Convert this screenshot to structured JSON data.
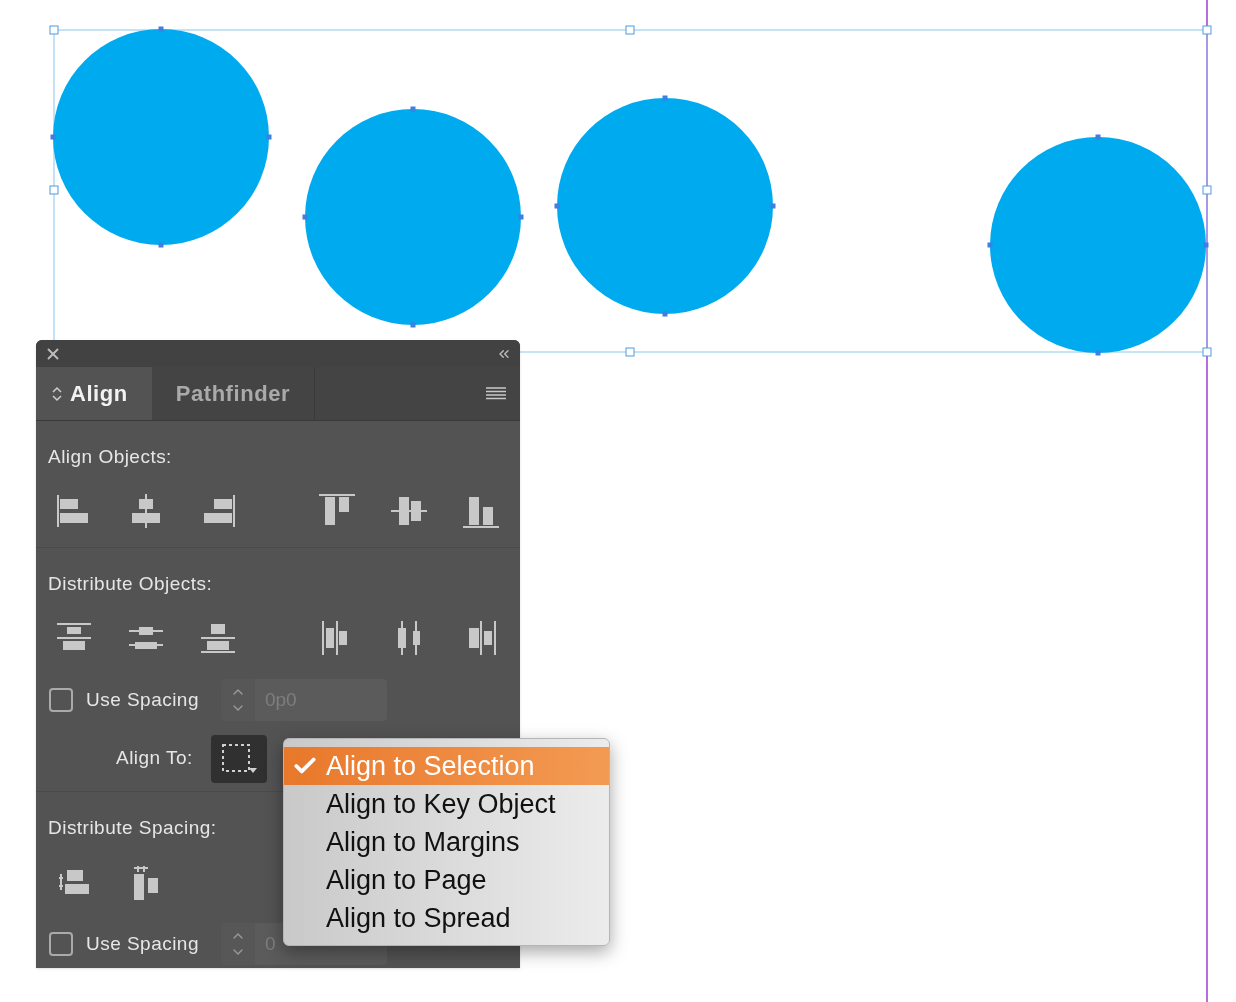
{
  "panel": {
    "tabs": [
      {
        "label": "Align",
        "selected": true
      },
      {
        "label": "Pathfinder",
        "selected": false
      }
    ],
    "sections": [
      {
        "kind": "align_icons",
        "title": "Align Objects:"
      },
      {
        "kind": "distribute_icons",
        "title": "Distribute Objects:"
      },
      {
        "kind": "spacing",
        "label": "Use Spacing",
        "checked": false,
        "value": "0p0"
      },
      {
        "kind": "align_to",
        "label": "Align To:"
      },
      {
        "kind": "spacing_icons",
        "title": "Distribute Spacing:"
      },
      {
        "kind": "spacing",
        "label": "Use Spacing",
        "checked": false,
        "value": "0"
      }
    ]
  },
  "menu": {
    "items": [
      {
        "label": "Align to Selection",
        "selected": true
      },
      {
        "label": "Align to Key Object",
        "selected": false
      },
      {
        "label": "Align to Margins",
        "selected": false
      },
      {
        "label": "Align to Page",
        "selected": false
      },
      {
        "label": "Align to Spread",
        "selected": false
      }
    ]
  }
}
